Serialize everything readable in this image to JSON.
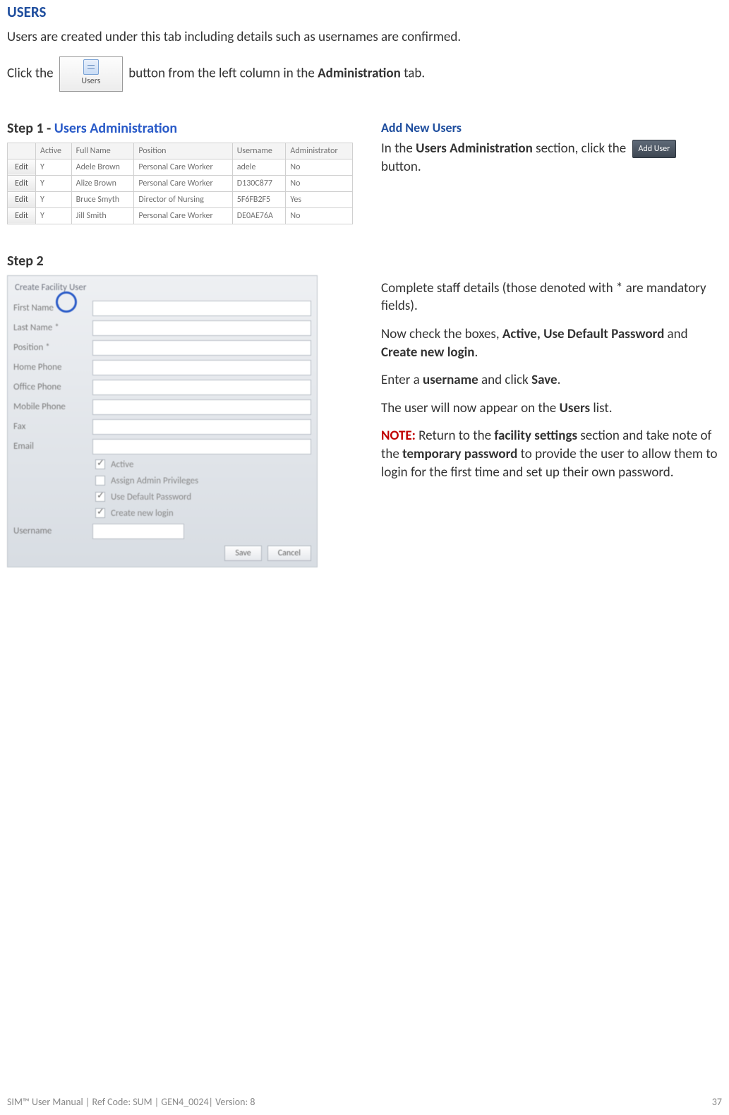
{
  "heading": "USERS",
  "intro": "Users are created under this tab including details such as usernames are confirmed.",
  "click_the": "Click the ",
  "users_btn_label": "Users",
  "click_the_after": " button from the left column in the ",
  "admin_tab": "Administration",
  "click_the_tail": " tab.",
  "step1_label": "Step 1",
  "step1_sep": "  - ",
  "step1_title": "Users Administration",
  "add_new_users": "Add New Users",
  "step1_desc_a": "In the ",
  "step1_desc_bold": "Users Administration",
  "step1_desc_b": " section, click the ",
  "add_user_btn": "Add User",
  "step1_desc_c": " button.",
  "grid": {
    "headers": [
      "",
      "Active",
      "Full Name",
      "Position",
      "Username",
      "Administrator"
    ],
    "rows": [
      [
        "Edit",
        "Y",
        "Adele Brown",
        "Personal Care Worker",
        "adele",
        "No"
      ],
      [
        "Edit",
        "Y",
        "Alize Brown",
        "Personal Care Worker",
        "D130C877",
        "No"
      ],
      [
        "Edit",
        "Y",
        "Bruce Smyth",
        "Director of Nursing",
        "5F6FB2F5",
        "Yes"
      ],
      [
        "Edit",
        "Y",
        "Jill Smith",
        "Personal Care Worker",
        "DE0AE76A",
        "No"
      ]
    ]
  },
  "step2_label": "Step 2",
  "form": {
    "title": "Create Facility User",
    "fields": [
      {
        "label": "First Name *",
        "value": ""
      },
      {
        "label": "Last Name *",
        "value": ""
      },
      {
        "label": "Position *",
        "value": ""
      },
      {
        "label": "Home Phone",
        "value": ""
      },
      {
        "label": "Office Phone",
        "value": ""
      },
      {
        "label": "Mobile Phone",
        "value": ""
      },
      {
        "label": "Fax",
        "value": ""
      },
      {
        "label": "Email",
        "value": ""
      }
    ],
    "checkboxes": [
      {
        "label": "Active",
        "checked": true
      },
      {
        "label": "Assign Admin Privileges",
        "checked": false
      },
      {
        "label": "Use Default Password",
        "checked": true
      },
      {
        "label": "Create new login",
        "checked": true
      }
    ],
    "username_label": "Username",
    "save": "Save",
    "cancel": "Cancel"
  },
  "step2_text": {
    "p1": "Complete staff details (those denoted with * are mandatory fields).",
    "p2_a": "Now check the boxes, ",
    "p2_b": "Active, Use Default Password",
    "p2_c": " and ",
    "p2_d": "Create new login",
    "p2_e": ".",
    "p3_a": "Enter a ",
    "p3_b": "username",
    "p3_c": " and click ",
    "p3_d": "Save",
    "p3_e": ".",
    "p4_a": "The user will now appear on the ",
    "p4_b": "Users",
    "p4_c": " list.",
    "note": "NOTE:",
    "p5_a": " Return to the ",
    "p5_b": "facility settings",
    "p5_c": " section and take note of the ",
    "p5_d": "temporary password",
    "p5_e": " to provide the user to allow them to login for the first time and set up their own password."
  },
  "footer_left": "SIM™ User Manual | Ref Code: SUM | GEN4_0024| Version: 8",
  "footer_right": "37"
}
